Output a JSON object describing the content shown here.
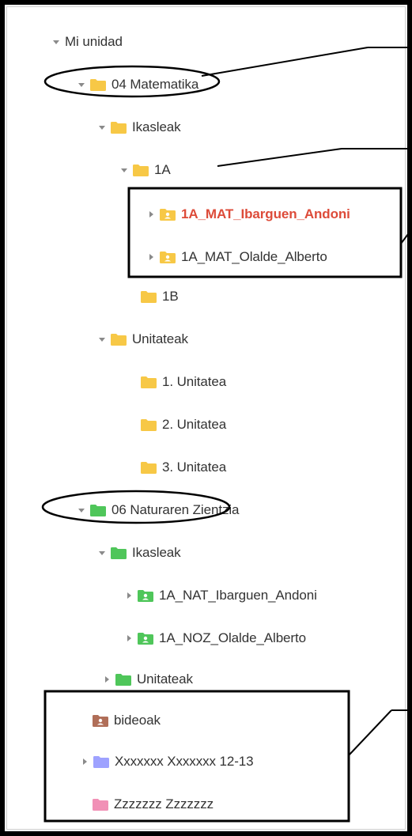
{
  "colors": {
    "yellow_folder": "#f7c846",
    "green_folder": "#4fc65a",
    "brown_folder": "#b06e58",
    "purple_folder": "#9ea2ff",
    "pink_folder": "#f190b6",
    "red_text": "#dd4b39",
    "text": "#333333",
    "arrow": "#8a8a8a"
  },
  "tree": {
    "root": "Mi unidad",
    "matematika": "04 Matematika",
    "mat_ikasleak": "Ikasleak",
    "mat_1a": "1A",
    "mat_student1": "1A_MAT_Ibarguen_Andoni",
    "mat_student2": "1A_MAT_Olalde_Alberto",
    "mat_1b": "1B",
    "mat_unitateak": "Unitateak",
    "unit1": "1. Unitatea",
    "unit2": "2. Unitatea",
    "unit3": "3. Unitatea",
    "natura": "06 Naturaren Zientzia",
    "nat_ikasleak": "Ikasleak",
    "nat_student1": "1A_NAT_Ibarguen_Andoni",
    "nat_student2": "1A_NOZ_Olalde_Alberto",
    "nat_unitateak": "Unitateak",
    "bideoak": "bideoak",
    "xfolder": "Xxxxxxx Xxxxxxx 12-13",
    "zfolder": "Zzzzzzz Zzzzzzz"
  }
}
